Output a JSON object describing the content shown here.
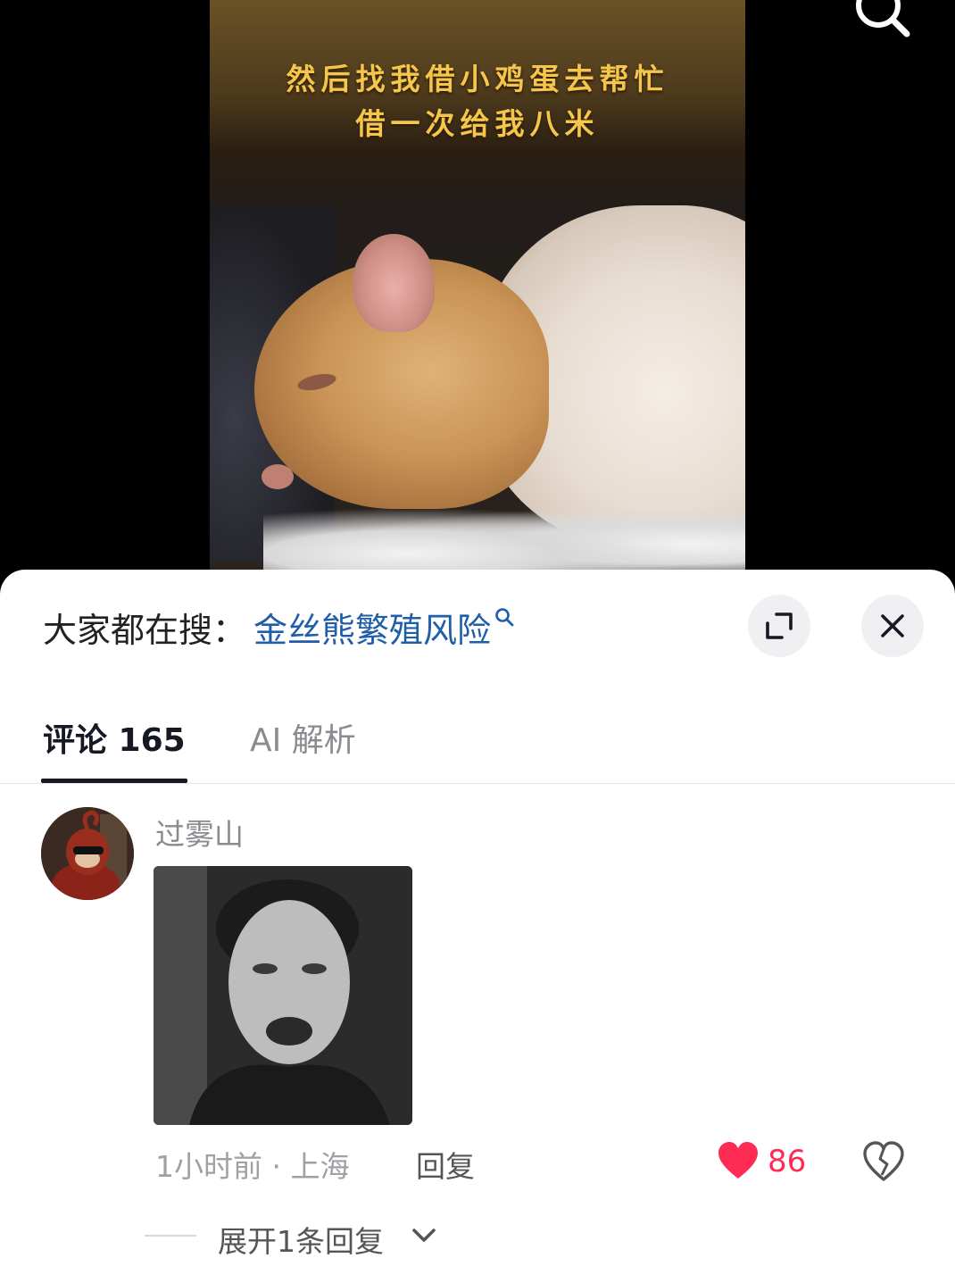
{
  "video": {
    "caption_line1": "然后找我借小鸡蛋去帮忙",
    "caption_line2": "借一次给我八米"
  },
  "panel": {
    "search_prefix": "大家都在搜：",
    "search_term": "金丝熊繁殖风险"
  },
  "tabs": {
    "comments": "评论 165",
    "ai": "AI 解析"
  },
  "comment": {
    "username": "过雾山",
    "meta": "1小时前 · 上海",
    "reply_label": "回复",
    "like_count": "86",
    "expand_label": "展开1条回复"
  },
  "colors": {
    "accent_link": "#1f5ea8",
    "like": "#fe2c55",
    "caption": "#f6c64a"
  }
}
